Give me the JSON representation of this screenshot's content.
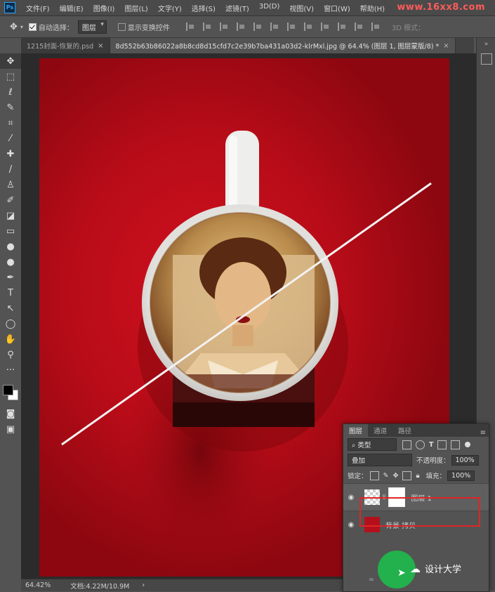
{
  "menubar": {
    "logo": "Ps",
    "items": [
      "文件(F)",
      "编辑(E)",
      "图像(I)",
      "图层(L)",
      "文字(Y)",
      "选择(S)",
      "滤镜(T)",
      "3D(D)",
      "视图(V)",
      "窗口(W)",
      "帮助(H)"
    ],
    "watermark": "www.16xx8.com"
  },
  "options": {
    "move_glyph": "✥",
    "auto_select_label": "自动选择：",
    "auto_select_value": "图层",
    "show_transform_label": "显示变换控件",
    "mode_3d_label": "3D 模式："
  },
  "tabs": [
    {
      "label": "1215封面-恢复的.psd",
      "close": "×"
    },
    {
      "label": "8d552b63b86022a8b8cd8d15cfd7c2e39b7ba431a03d2-klrMxl.jpg @ 64.4% (图层 1, 图层蒙版/8) *",
      "close": "×"
    }
  ],
  "toolbar": {
    "tools": [
      {
        "name": "move-tool-icon",
        "glyph": "✥"
      },
      {
        "name": "marquee-tool-icon",
        "glyph": "⬚"
      },
      {
        "name": "lasso-tool-icon",
        "glyph": "ℓ"
      },
      {
        "name": "quick-select-tool-icon",
        "glyph": "✎"
      },
      {
        "name": "crop-tool-icon",
        "glyph": "⌗"
      },
      {
        "name": "eyedropper-tool-icon",
        "glyph": "⁄"
      },
      {
        "name": "healing-tool-icon",
        "glyph": "✚"
      },
      {
        "name": "brush-tool-icon",
        "glyph": "/"
      },
      {
        "name": "stamp-tool-icon",
        "glyph": "♙"
      },
      {
        "name": "history-brush-icon",
        "glyph": "✐"
      },
      {
        "name": "eraser-tool-icon",
        "glyph": "◪"
      },
      {
        "name": "gradient-tool-icon",
        "glyph": "▭"
      },
      {
        "name": "blur-tool-icon",
        "glyph": "●"
      },
      {
        "name": "dodge-tool-icon",
        "glyph": "●"
      },
      {
        "name": "pen-tool-icon",
        "glyph": "✒"
      },
      {
        "name": "type-tool-icon",
        "glyph": "T"
      },
      {
        "name": "path-select-tool-icon",
        "glyph": "↖"
      },
      {
        "name": "shape-tool-icon",
        "glyph": "◯"
      },
      {
        "name": "hand-tool-icon",
        "glyph": "✋"
      },
      {
        "name": "zoom-tool-icon",
        "glyph": "⚲"
      },
      {
        "name": "more-tools-icon",
        "glyph": "···"
      }
    ],
    "colors": {
      "foreground": "#000000",
      "background": "#ffffff"
    }
  },
  "status": {
    "zoom": "64.42%",
    "doc": "文档:4.22M/10.9M",
    "arrow": "›"
  },
  "layers_panel": {
    "tabs": [
      "图层",
      "通道",
      "路径"
    ],
    "filter_label": "类型",
    "blend_mode": "叠加",
    "opacity_label": "不透明度：",
    "opacity_value": "100%",
    "lock_label": "锁定：",
    "fill_label": "填充：",
    "fill_value": "100%",
    "layers": [
      {
        "name": "图层 1",
        "selected": true
      },
      {
        "name": "背景 拷贝",
        "selected": false
      }
    ]
  },
  "wechat_watermark": "设计大学",
  "colors": {
    "canvas_red": "#c40f1c",
    "highlight": "#e02525",
    "wechat_green": "#22b14c"
  }
}
